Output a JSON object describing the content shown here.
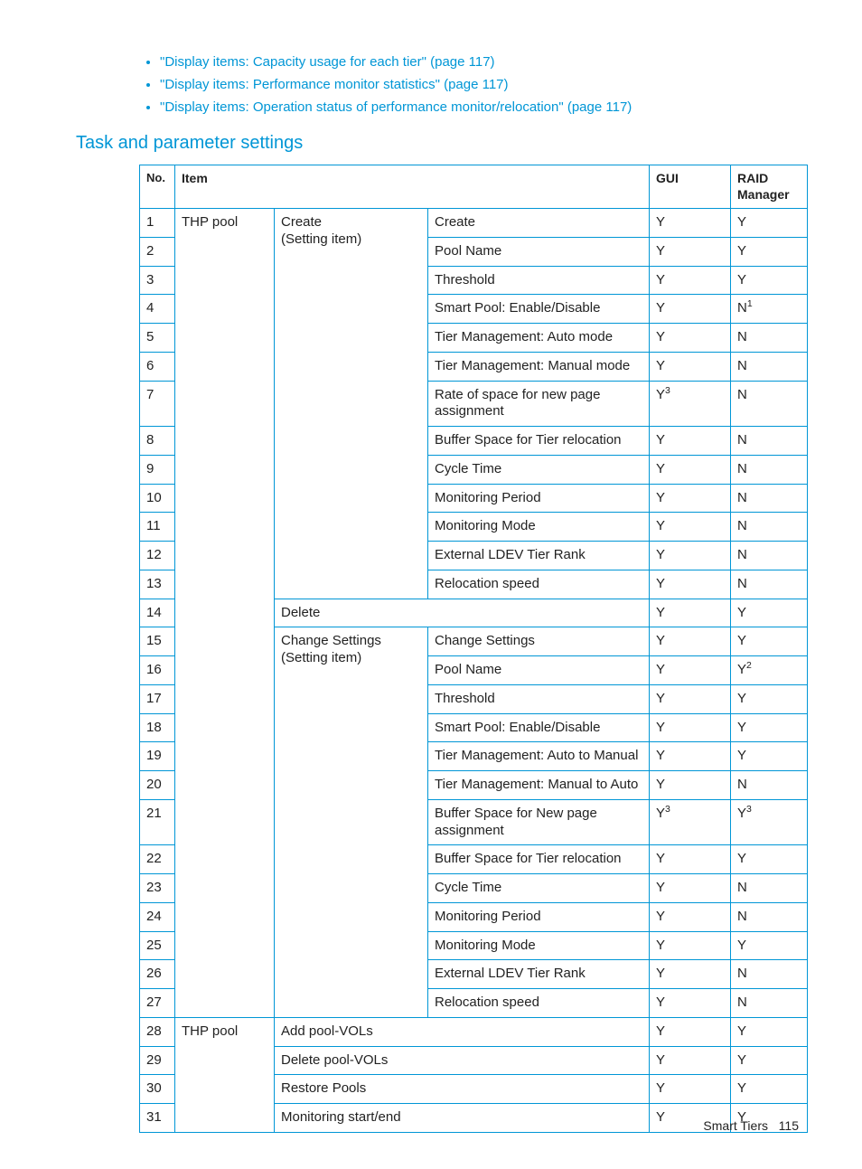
{
  "links": [
    "\"Display items: Capacity usage for each tier\" (page 117)",
    "\"Display items: Performance monitor statistics\" (page 117)",
    "\"Display items: Operation status of performance monitor/relocation\" (page 117)"
  ],
  "section_heading": "Task and parameter settings",
  "table": {
    "headers": [
      "No.",
      "Item",
      "GUI",
      "RAID Manager"
    ],
    "rows": [
      {
        "no": "1",
        "sub": "Create",
        "gui": "Y",
        "rm": "Y"
      },
      {
        "no": "2",
        "sub": "Pool Name",
        "gui": "Y",
        "rm": "Y"
      },
      {
        "no": "3",
        "sub": "Threshold",
        "gui": "Y",
        "rm": "Y"
      },
      {
        "no": "4",
        "sub": "Smart Pool: Enable/Disable",
        "gui": "Y",
        "rm": "N",
        "rm_sup": "1"
      },
      {
        "no": "5",
        "sub": "Tier Management: Auto mode",
        "gui": "Y",
        "rm": "N"
      },
      {
        "no": "6",
        "sub": "Tier Management: Manual mode",
        "gui": "Y",
        "rm": "N"
      },
      {
        "no": "7",
        "sub": "Rate of space for new page assignment",
        "gui": "Y",
        "gui_sup": "3",
        "rm": "N"
      },
      {
        "no": "8",
        "sub": "Buffer Space for Tier relocation",
        "gui": "Y",
        "rm": "N"
      },
      {
        "no": "9",
        "sub": "Cycle Time",
        "gui": "Y",
        "rm": "N"
      },
      {
        "no": "10",
        "sub": "Monitoring Period",
        "gui": "Y",
        "rm": "N"
      },
      {
        "no": "11",
        "sub": "Monitoring Mode",
        "gui": "Y",
        "rm": "N"
      },
      {
        "no": "12",
        "sub": "External LDEV Tier Rank",
        "gui": "Y",
        "rm": "N"
      },
      {
        "no": "13",
        "sub": "Relocation speed",
        "gui": "Y",
        "rm": "N"
      },
      {
        "no": "14",
        "sub": "Delete",
        "span": true,
        "gui": "Y",
        "rm": "Y"
      },
      {
        "no": "15",
        "sub": "Change Settings",
        "gui": "Y",
        "rm": "Y"
      },
      {
        "no": "16",
        "sub": "Pool Name",
        "gui": "Y",
        "rm": "Y",
        "rm_sup": "2"
      },
      {
        "no": "17",
        "sub": "Threshold",
        "gui": "Y",
        "rm": "Y"
      },
      {
        "no": "18",
        "sub": "Smart Pool: Enable/Disable",
        "gui": "Y",
        "rm": "Y"
      },
      {
        "no": "19",
        "sub": "Tier Management: Auto to Manual",
        "gui": "Y",
        "rm": "Y"
      },
      {
        "no": "20",
        "sub": "Tier Management: Manual to Auto",
        "gui": "Y",
        "rm": "N"
      },
      {
        "no": "21",
        "sub": "Buffer Space for New page assignment",
        "gui": "Y",
        "gui_sup": "3",
        "rm": "Y",
        "rm_sup": "3"
      },
      {
        "no": "22",
        "sub": "Buffer Space for Tier relocation",
        "gui": "Y",
        "rm": "Y"
      },
      {
        "no": "23",
        "sub": "Cycle Time",
        "gui": "Y",
        "rm": "N"
      },
      {
        "no": "24",
        "sub": "Monitoring Period",
        "gui": "Y",
        "rm": "N"
      },
      {
        "no": "25",
        "sub": "Monitoring Mode",
        "gui": "Y",
        "rm": "Y"
      },
      {
        "no": "26",
        "sub": "External LDEV Tier Rank",
        "gui": "Y",
        "rm": "N"
      },
      {
        "no": "27",
        "sub": "Relocation speed",
        "gui": "Y",
        "rm": "N"
      },
      {
        "no": "28",
        "sub": "Add pool-VOLs",
        "span": true,
        "gui": "Y",
        "rm": "Y"
      },
      {
        "no": "29",
        "sub": "Delete pool-VOLs",
        "span": true,
        "gui": "Y",
        "rm": "Y"
      },
      {
        "no": "30",
        "sub": "Restore Pools",
        "span": true,
        "gui": "Y",
        "rm": "Y"
      },
      {
        "no": "31",
        "sub": "Monitoring start/end",
        "span": true,
        "gui": "Y",
        "rm": "Y"
      }
    ],
    "item_col_1_label": "THP pool",
    "create_group": {
      "title": "Create",
      "subtitle": "(Setting item)"
    },
    "change_group": {
      "title": "Change Settings",
      "subtitle": "(Setting item)"
    },
    "item_col_2_label": "THP pool"
  },
  "footer": {
    "section": "Smart Tiers",
    "page": "115"
  }
}
